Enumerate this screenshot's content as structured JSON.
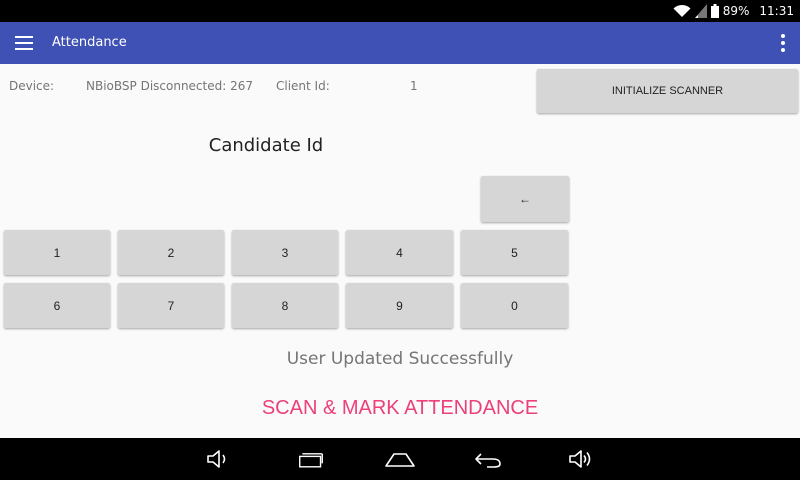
{
  "status_bar": {
    "battery": "89%",
    "time": "11:31",
    "icons": [
      "wifi-icon",
      "signal-icon",
      "battery-icon"
    ]
  },
  "app_bar": {
    "title": "Attendance",
    "icons": [
      "menu-icon",
      "overflow-menu-icon"
    ]
  },
  "device_info": {
    "device_label": "Device:",
    "device_value": "NBioBSP Disconnected: 267",
    "client_label": "Client Id:",
    "client_value": "1"
  },
  "initialize_button": "INITIALIZE SCANNER",
  "candidate_label": "Candidate Id",
  "keypad": {
    "backspace": "←",
    "row1": [
      "1",
      "2",
      "3",
      "4",
      "5"
    ],
    "row2": [
      "6",
      "7",
      "8",
      "9",
      "0"
    ]
  },
  "status_message": "User Updated Successfully",
  "scan_button": "SCAN & MARK ATTENDANCE",
  "nav_bar": {
    "icons": [
      "volume-down-icon",
      "recents-icon",
      "home-icon",
      "back-icon",
      "volume-up-icon"
    ]
  },
  "colors": {
    "app_bar": "#3f51b5",
    "accent": "#ec407a",
    "button_bg": "#d6d6d6"
  }
}
